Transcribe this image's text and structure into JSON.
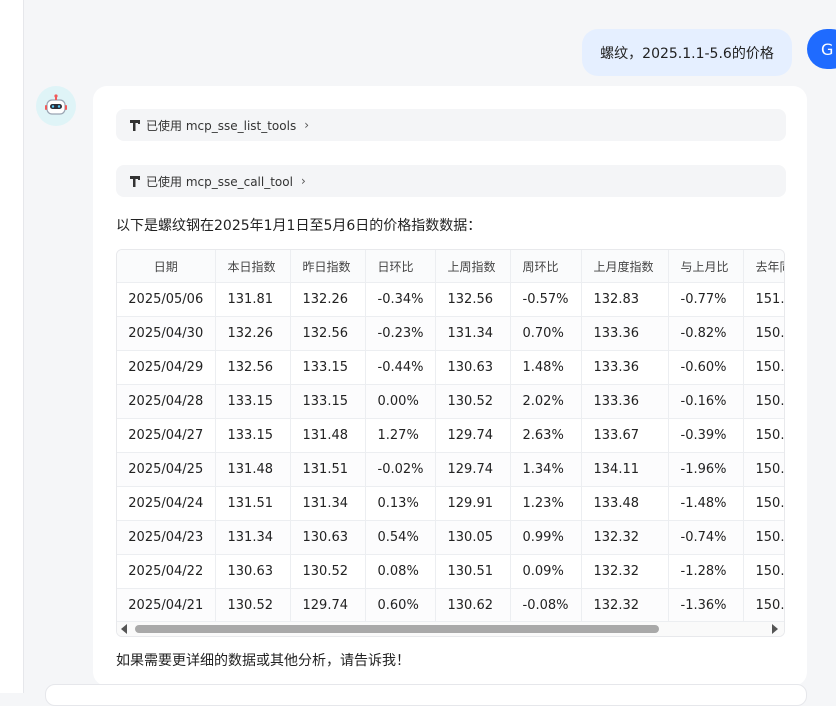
{
  "user_message": "螺纹，2025.1.1-5.6的价格",
  "user_avatar_letter": "G",
  "tools": [
    {
      "label": "已使用 mcp_sse_list_tools"
    },
    {
      "label": "已使用 mcp_sse_call_tool"
    }
  ],
  "intro": "以下是螺纹钢在2025年1月1日至5月6日的价格指数数据：",
  "table": {
    "headers": [
      "日期",
      "本日指数",
      "昨日指数",
      "日环比",
      "上周指数",
      "周环比",
      "上月度指数",
      "与上月比",
      "去年同"
    ],
    "rows": [
      [
        "2025/05/06",
        "131.81",
        "132.26",
        "-0.34%",
        "132.56",
        "-0.57%",
        "132.83",
        "-0.77%",
        "151."
      ],
      [
        "2025/04/30",
        "132.26",
        "132.56",
        "-0.23%",
        "131.34",
        "0.70%",
        "133.36",
        "-0.82%",
        "150."
      ],
      [
        "2025/04/29",
        "132.56",
        "133.15",
        "-0.44%",
        "130.63",
        "1.48%",
        "133.36",
        "-0.60%",
        "150."
      ],
      [
        "2025/04/28",
        "133.15",
        "133.15",
        "0.00%",
        "130.52",
        "2.02%",
        "133.36",
        "-0.16%",
        "150."
      ],
      [
        "2025/04/27",
        "133.15",
        "131.48",
        "1.27%",
        "129.74",
        "2.63%",
        "133.67",
        "-0.39%",
        "150."
      ],
      [
        "2025/04/25",
        "131.48",
        "131.51",
        "-0.02%",
        "129.74",
        "1.34%",
        "134.11",
        "-1.96%",
        "150."
      ],
      [
        "2025/04/24",
        "131.51",
        "131.34",
        "0.13%",
        "129.91",
        "1.23%",
        "133.48",
        "-1.48%",
        "150."
      ],
      [
        "2025/04/23",
        "131.34",
        "130.63",
        "0.54%",
        "130.05",
        "0.99%",
        "132.32",
        "-0.74%",
        "150."
      ],
      [
        "2025/04/22",
        "130.63",
        "130.52",
        "0.08%",
        "130.51",
        "0.09%",
        "132.32",
        "-1.28%",
        "150."
      ],
      [
        "2025/04/21",
        "130.52",
        "129.74",
        "0.60%",
        "130.62",
        "-0.08%",
        "132.32",
        "-1.36%",
        "150."
      ]
    ]
  },
  "outro": "如果需要更详细的数据或其他分析，请告诉我！",
  "colors": {
    "accent": "#1f6bff",
    "user_bubble": "#e5efff",
    "page_bg": "#f5f6f8"
  }
}
